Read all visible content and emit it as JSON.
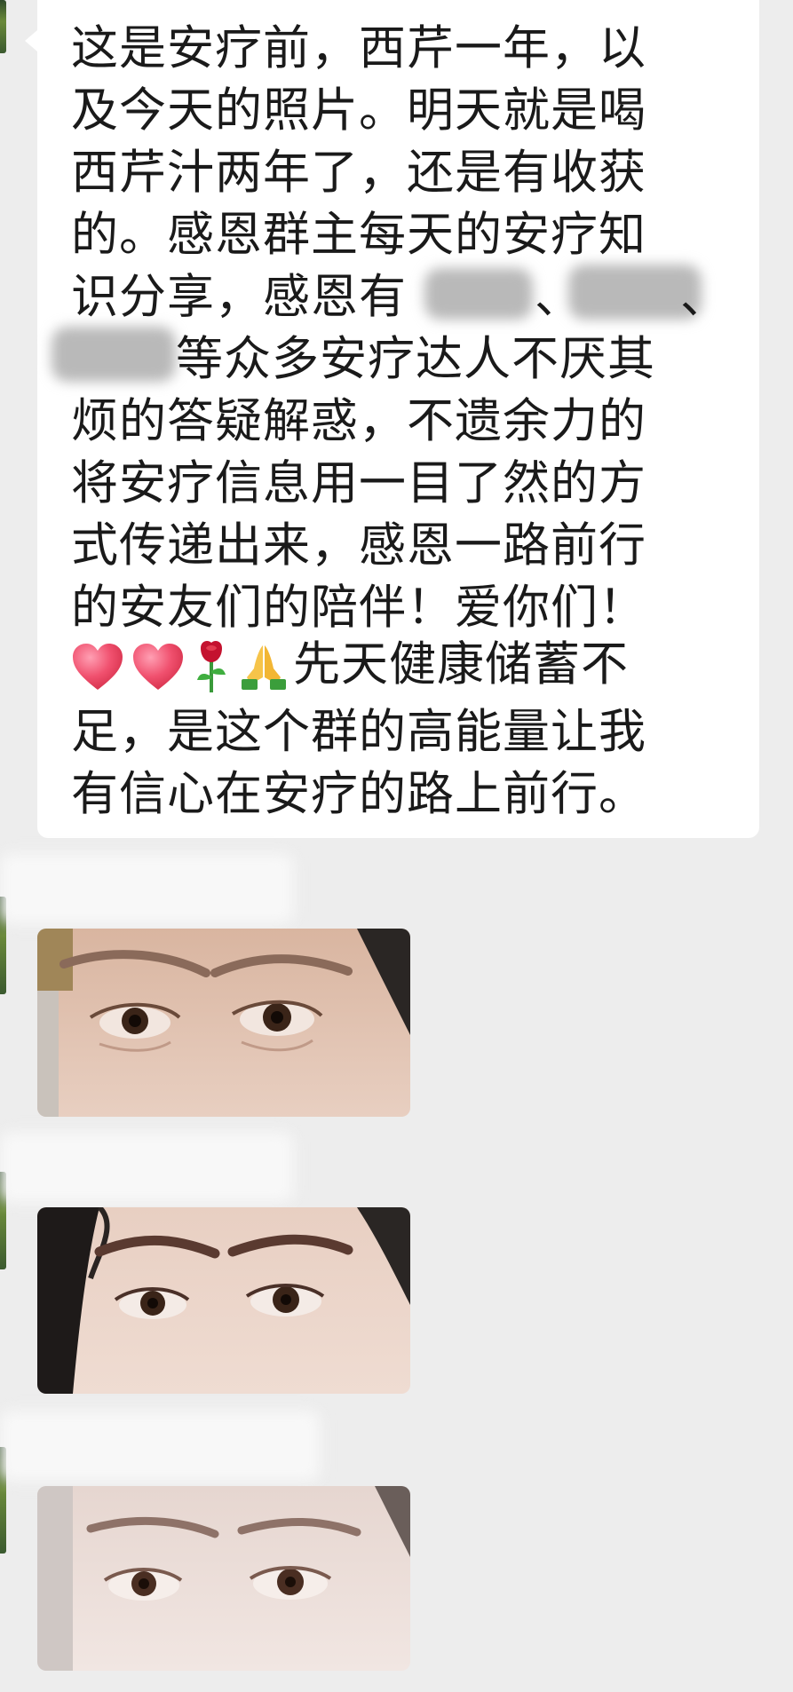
{
  "chat": {
    "message_lines": [
      "这是安疗前，西芹一年，以",
      "及今天的照片。明天就是喝",
      "西芹汁两年了，还是有收获",
      "的。感恩群主每天的安疗知",
      "识分享，感恩有",
      "等众多安疗达人不厌其",
      "烦的答疑解惑，不遗余力的",
      "将安疗信息用一目了然的方",
      "式传递出来，感恩一路前行",
      "的安友们的陪伴！爱你们！",
      "先天健康储蓄不",
      "足，是这个群的高能量让我",
      "有信心在安疗的路上前行。"
    ],
    "separator_1": "、",
    "separator_2": "、",
    "emojis": [
      "heart-emoji",
      "heart-emoji",
      "rose-emoji",
      "pray-emoji"
    ],
    "photos": [
      {
        "name": "photo-before"
      },
      {
        "name": "photo-one-year"
      },
      {
        "name": "photo-today"
      }
    ]
  },
  "colors": {
    "background": "#ededed",
    "bubble": "#ffffff",
    "text": "#1a1a1a",
    "heart": "#f0506e",
    "rose": "#c4122f"
  }
}
